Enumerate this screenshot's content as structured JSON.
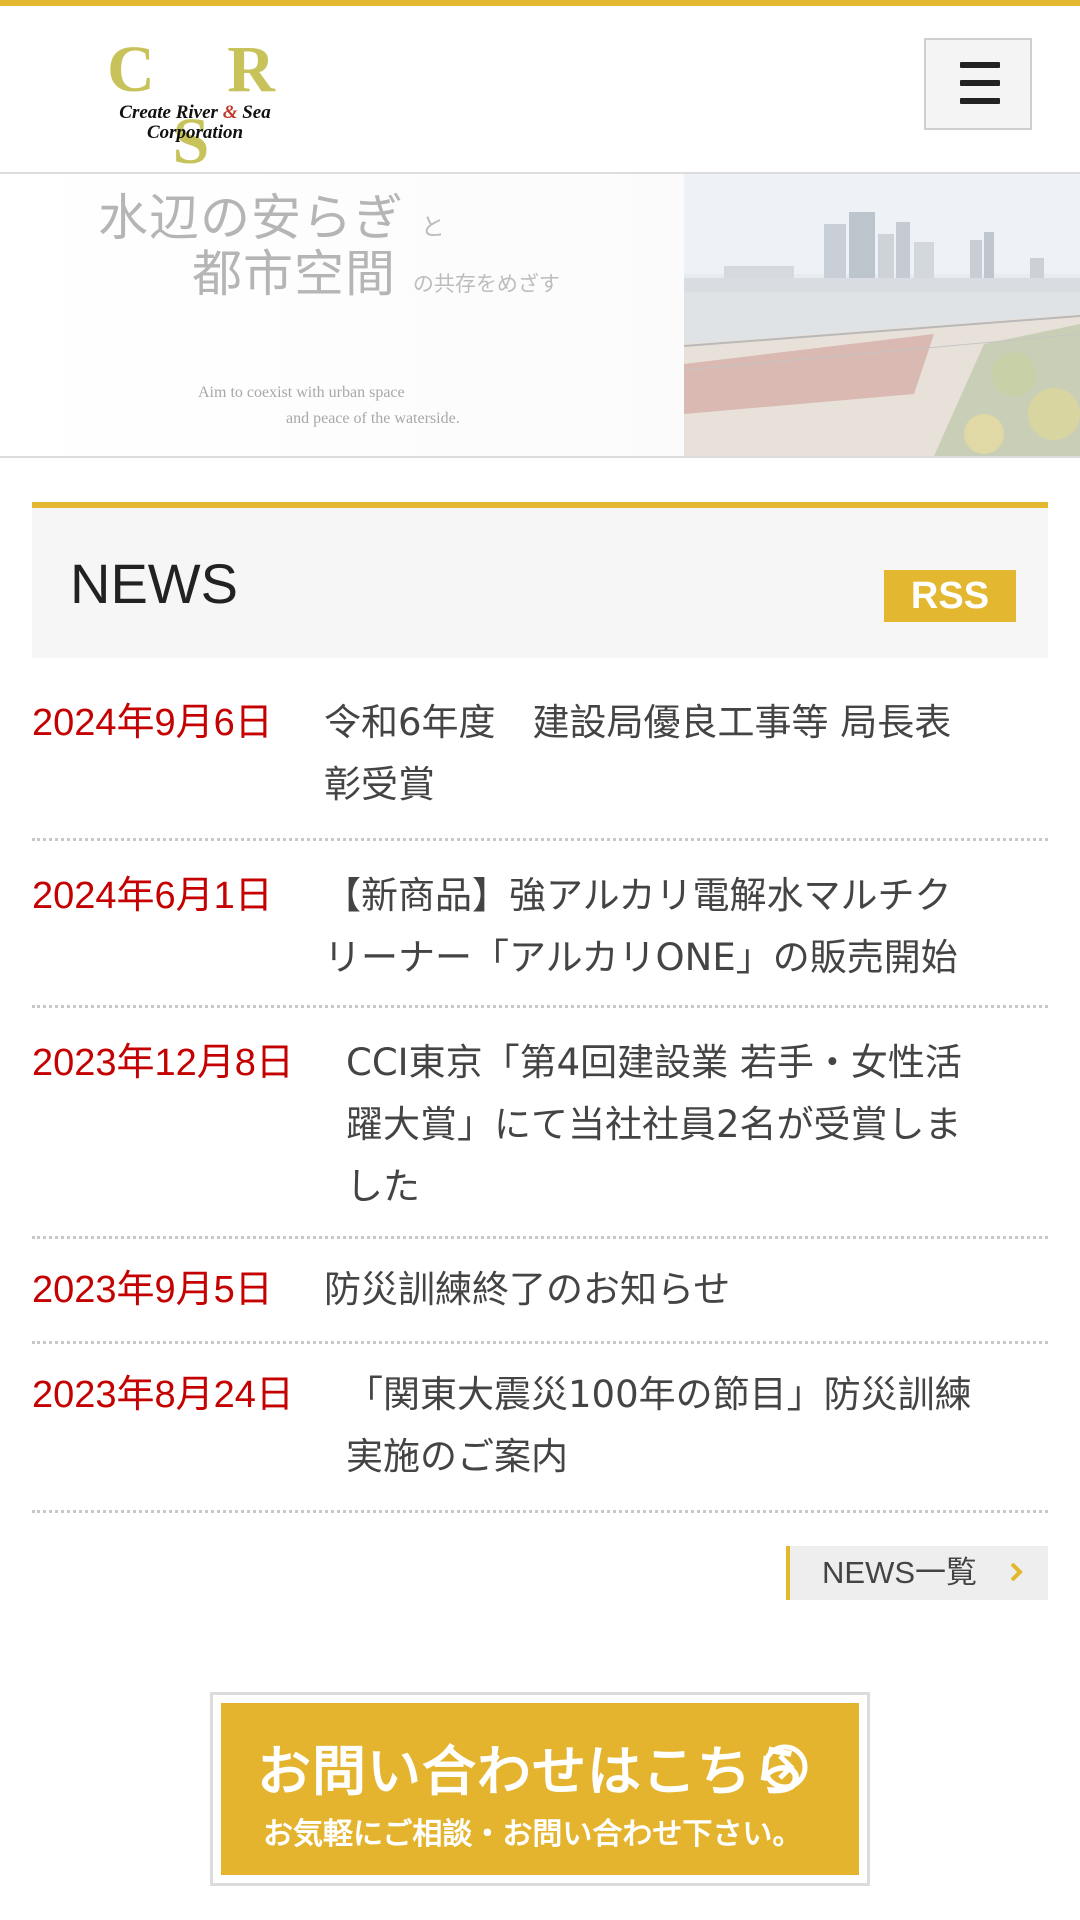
{
  "colors": {
    "accent": "#e3b72f",
    "date": "#c40000",
    "logo": "#c7c35a"
  },
  "header": {
    "logo": {
      "letters": "C R S",
      "line1_a": "Create River ",
      "line1_amp": "&",
      "line1_b": " Sea",
      "line2": "Corporation"
    },
    "menu_icon": "hamburger-menu-icon"
  },
  "hero": {
    "line1_main": "水辺の安らぎ",
    "line1_small": "と",
    "line2_main": "都市空間",
    "line2_small": "の共存をめざす",
    "en_line1": "Aim to coexist with urban space",
    "en_line2": "and peace of the waterside."
  },
  "news": {
    "title": "NEWS",
    "rss_label": "RSS",
    "items": [
      {
        "date": "2024年9月6日",
        "lines": [
          "令和6年度　建設局優良工事等 局長表",
          "彰受賞"
        ]
      },
      {
        "date": "2024年6月1日",
        "lines": [
          "【新商品】強アルカリ電解水マルチク",
          "リーナー「アルカリONE」の販売開始"
        ]
      },
      {
        "date": "2023年12月8日",
        "lines": [
          "CCI東京「第4回建設業 若手・女性活",
          "躍大賞」にて当社社員2名が受賞しま",
          "した"
        ]
      },
      {
        "date": "2023年9月5日",
        "lines": [
          "防災訓練終了のお知らせ"
        ]
      },
      {
        "date": "2023年8月24日",
        "lines": [
          "「関東大震災100年の節目」防災訓練",
          "実施のご案内"
        ]
      }
    ],
    "more_label": "NEWS一覧"
  },
  "contact": {
    "main": "お問い合わせはこちら",
    "sub": "お気軽にご相談・お問い合わせ下さい。"
  }
}
